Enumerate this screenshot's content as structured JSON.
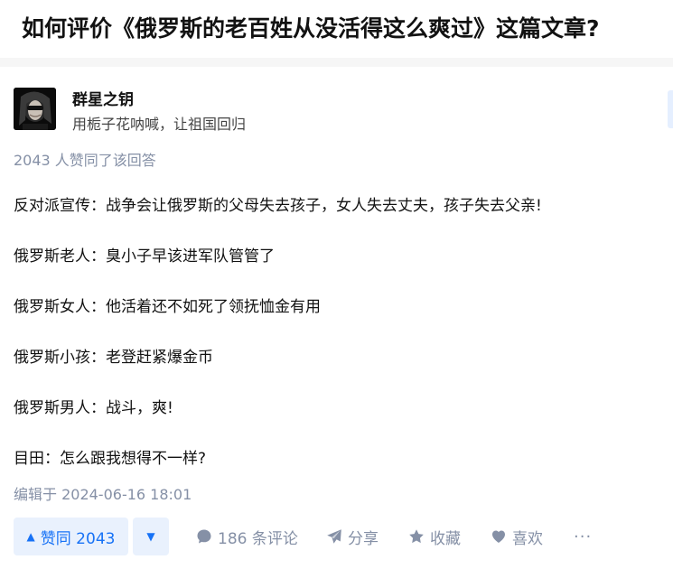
{
  "question": {
    "title": "如何评价《俄罗斯的老百姓从没活得这么爽过》这篇文章?"
  },
  "author": {
    "name": "群星之钥",
    "bio": "用栀子花呐喊，让祖国回归"
  },
  "vote_summary": "2043 人赞同了该回答",
  "content": {
    "paragraphs": [
      "反对派宣传：战争会让俄罗斯的父母失去孩子，女人失去丈夫，孩子失去父亲!",
      "俄罗斯老人：臭小子早该进军队管管了",
      "俄罗斯女人：他活着还不如死了领抚恤金有用",
      "俄罗斯小孩：老登赶紧爆金币",
      "俄罗斯男人：战斗，爽!",
      "目田：怎么跟我想得不一样?"
    ]
  },
  "edit_time": "编辑于 2024-06-16 18:01",
  "actions": {
    "vote_up_label": "赞同 2043",
    "comment_label": "186 条评论",
    "share_label": "分享",
    "collect_label": "收藏",
    "like_label": "喜欢",
    "more_label": "···"
  },
  "colors": {
    "accent": "#1772f6",
    "accent_bg": "#e9f1fd",
    "meta_gray": "#8590a6",
    "text": "#121212"
  },
  "icons": {
    "vote_up": "triangle-up-icon",
    "vote_down": "triangle-down-icon",
    "comment": "comment-bubble-icon",
    "share": "paper-plane-icon",
    "collect": "star-icon",
    "like": "heart-icon",
    "more": "ellipsis-icon"
  }
}
